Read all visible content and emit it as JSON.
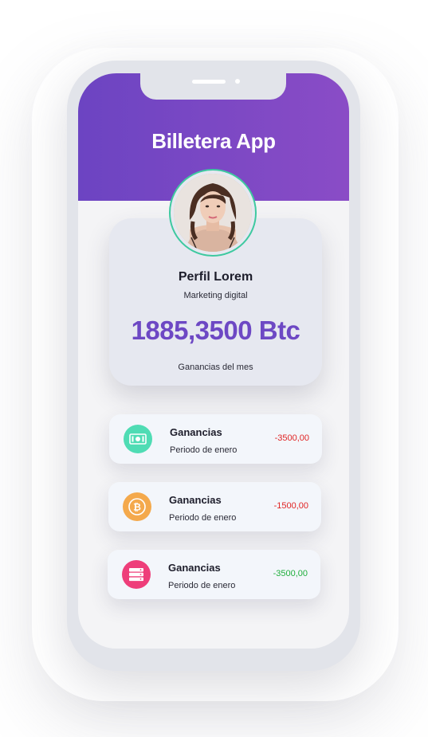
{
  "app": {
    "title": "Billetera App"
  },
  "profile": {
    "name": "Perfil Lorem",
    "role": "Marketing digital",
    "balance": "1885,3500 Btc",
    "balance_label": "Ganancias del mes"
  },
  "transactions": [
    {
      "icon": "cash-icon",
      "icon_color": "#4fdcb4",
      "title": "Ganancias",
      "subtitle": "Periodo de enero",
      "amount": "-3500,00",
      "amount_color": "#e02424"
    },
    {
      "icon": "bitcoin-icon",
      "icon_color": "#f4a94c",
      "title": "Ganancias",
      "subtitle": "Periodo de enero",
      "amount": "-1500,00",
      "amount_color": "#e02424"
    },
    {
      "icon": "server-icon",
      "icon_color": "#ee3e7a",
      "title": "Ganancias",
      "subtitle": "Periodo de enero",
      "amount": "-3500,00",
      "amount_color": "#1fae3c"
    }
  ],
  "colors": {
    "header_gradient_start": "#6c44c2",
    "header_gradient_end": "#8a4cc6",
    "accent": "#6d48c4",
    "avatar_ring": "#3ec9a0"
  }
}
